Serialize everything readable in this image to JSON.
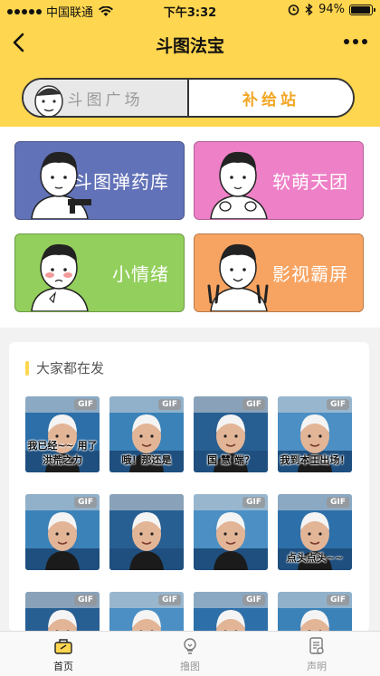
{
  "status": {
    "carrier": "中国联通",
    "time": "下午3:32",
    "battery": "94%",
    "battery_level": 0.94
  },
  "nav": {
    "title": "斗图法宝",
    "back_icon": "chevron-left-icon",
    "more_icon": "more-dots-icon"
  },
  "switch": {
    "left_label": "斗图广场",
    "right_label": "补给站",
    "active": "right"
  },
  "categories": [
    {
      "label": "斗图弹药库",
      "color": "#6272b8"
    },
    {
      "label": "软萌天团",
      "color": "#ee80c7"
    },
    {
      "label": "小情绪",
      "color": "#93cf5c"
    },
    {
      "label": "影视霸屏",
      "color": "#f7a462"
    }
  ],
  "hot": {
    "title": "大家都在发",
    "badge": "GIF",
    "items": [
      {
        "caption": "我已经~~ 用了洪荒之力",
        "gif": true
      },
      {
        "caption": "哦！那还是",
        "gif": true
      },
      {
        "caption": "国 慧 端？",
        "gif": true
      },
      {
        "caption": "我到本王出场！",
        "gif": true
      },
      {
        "caption": "",
        "gif": true
      },
      {
        "caption": "",
        "gif": false
      },
      {
        "caption": "",
        "gif": true
      },
      {
        "caption": "点头点头~~",
        "gif": true
      },
      {
        "caption": "",
        "gif": true
      },
      {
        "caption": "",
        "gif": true
      },
      {
        "caption": "",
        "gif": true
      },
      {
        "caption": "",
        "gif": true
      }
    ]
  },
  "tabs": [
    {
      "label": "首页",
      "icon": "home-icon",
      "active": true
    },
    {
      "label": "撸图",
      "icon": "bulb-icon",
      "active": false
    },
    {
      "label": "声明",
      "icon": "document-icon",
      "active": false
    }
  ]
}
